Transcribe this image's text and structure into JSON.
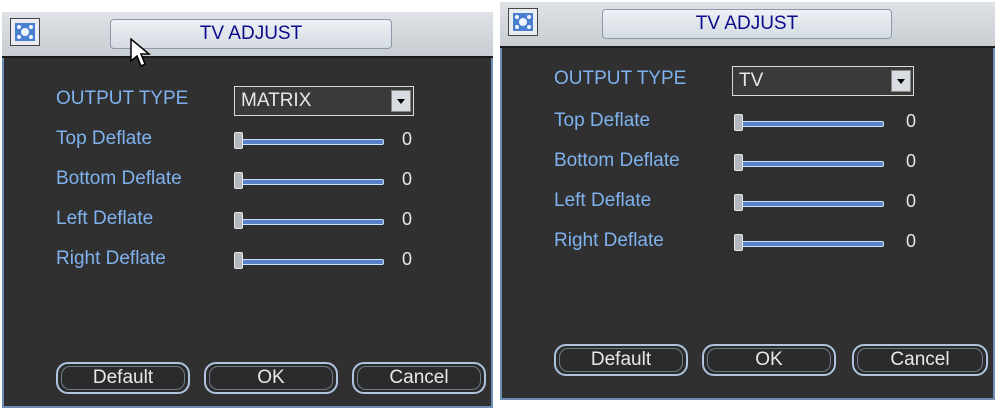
{
  "dialogs": [
    {
      "title": "TV ADJUST",
      "output_type": {
        "label": "OUTPUT TYPE",
        "value": "MATRIX"
      },
      "sliders": [
        {
          "label": "Top Deflate",
          "value": "0",
          "level": 0
        },
        {
          "label": "Bottom Deflate",
          "value": "0",
          "level": 0
        },
        {
          "label": "Left Deflate",
          "value": "0",
          "level": 0
        },
        {
          "label": "Right Deflate",
          "value": "0",
          "level": 0
        }
      ],
      "buttons": {
        "default": "Default",
        "ok": "OK",
        "cancel": "Cancel"
      }
    },
    {
      "title": "TV ADJUST",
      "output_type": {
        "label": "OUTPUT TYPE",
        "value": "TV"
      },
      "sliders": [
        {
          "label": "Top Deflate",
          "value": "0",
          "level": 0
        },
        {
          "label": "Bottom Deflate",
          "value": "0",
          "level": 0
        },
        {
          "label": "Left Deflate",
          "value": "0",
          "level": 0
        },
        {
          "label": "Right Deflate",
          "value": "0",
          "level": 0
        }
      ],
      "buttons": {
        "default": "Default",
        "ok": "OK",
        "cancel": "Cancel"
      }
    }
  ],
  "colors": {
    "label_text": "#7fb2ee",
    "title_text": "#0a0a8c",
    "panel_background": "#303030",
    "slider_track": "#5a82c8"
  },
  "icons": [
    "app-logo-icon",
    "mouse-pointer-icon",
    "dropdown-arrow-icon"
  ]
}
